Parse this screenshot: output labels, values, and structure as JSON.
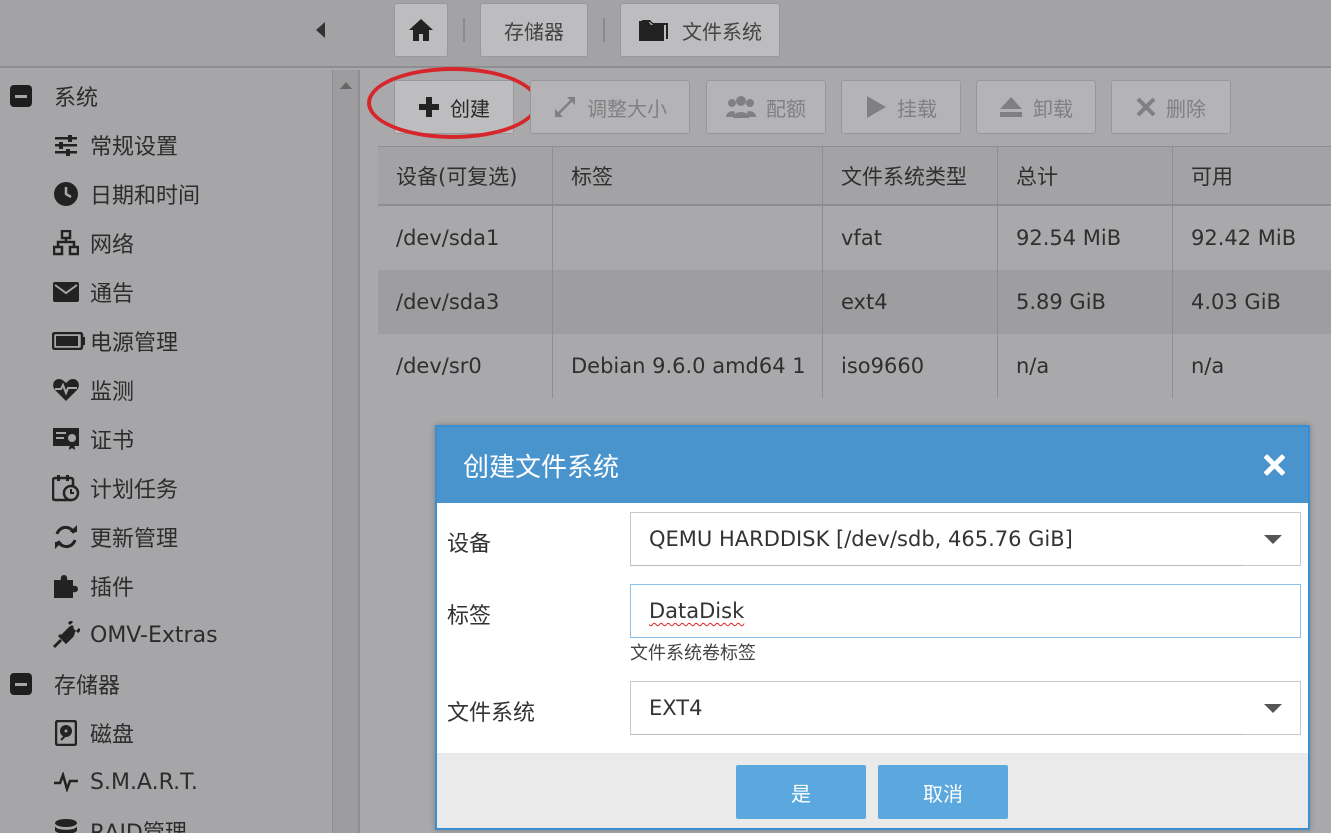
{
  "breadcrumb": {
    "storage": "存储器",
    "filesystem": "文件系统"
  },
  "sidebar": {
    "group_system": "系统",
    "system_items": [
      {
        "label": "常规设置",
        "icon": "sliders-icon"
      },
      {
        "label": "日期和时间",
        "icon": "clock-icon"
      },
      {
        "label": "网络",
        "icon": "network-icon"
      },
      {
        "label": "通告",
        "icon": "envelope-icon"
      },
      {
        "label": "电源管理",
        "icon": "battery-icon"
      },
      {
        "label": "监测",
        "icon": "heartbeat-icon"
      },
      {
        "label": "证书",
        "icon": "certificate-icon"
      },
      {
        "label": "计划任务",
        "icon": "calendar-clock-icon"
      },
      {
        "label": "更新管理",
        "icon": "refresh-icon"
      },
      {
        "label": "插件",
        "icon": "puzzle-icon"
      },
      {
        "label": "OMV-Extras",
        "icon": "plug-icon"
      }
    ],
    "group_storage": "存储器",
    "storage_items": [
      {
        "label": "磁盘",
        "icon": "harddisk-icon"
      },
      {
        "label": "S.M.A.R.T.",
        "icon": "pulse-icon"
      },
      {
        "label": "RAID管理",
        "icon": "database-icon"
      }
    ]
  },
  "toolbar": {
    "create": "创建",
    "resize": "调整大小",
    "quota": "配额",
    "mount": "挂载",
    "unmount": "卸载",
    "delete": "删除"
  },
  "table": {
    "columns": [
      "设备(可复选)",
      "标签",
      "文件系统类型",
      "总计",
      "可用"
    ],
    "rows": [
      [
        "/dev/sda1",
        "",
        "vfat",
        "92.54 MiB",
        "92.42 MiB"
      ],
      [
        "/dev/sda3",
        "",
        "ext4",
        "5.89 GiB",
        "4.03 GiB"
      ],
      [
        "/dev/sr0",
        "Debian 9.6.0 amd64 1",
        "iso9660",
        "n/a",
        "n/a"
      ]
    ]
  },
  "dialog": {
    "title": "创建文件系统",
    "device_label": "设备",
    "device_value": "QEMU HARDDISK [/dev/sdb, 465.76 GiB]",
    "label_label": "标签",
    "label_value": "DataDisk",
    "label_hint": "文件系统卷标签",
    "fs_label": "文件系统",
    "fs_value": "EXT4",
    "ok": "是",
    "cancel": "取消"
  },
  "colors": {
    "dialog_header": "#4a94cd",
    "button": "#5aa8de",
    "highlight": "#d7262b"
  }
}
